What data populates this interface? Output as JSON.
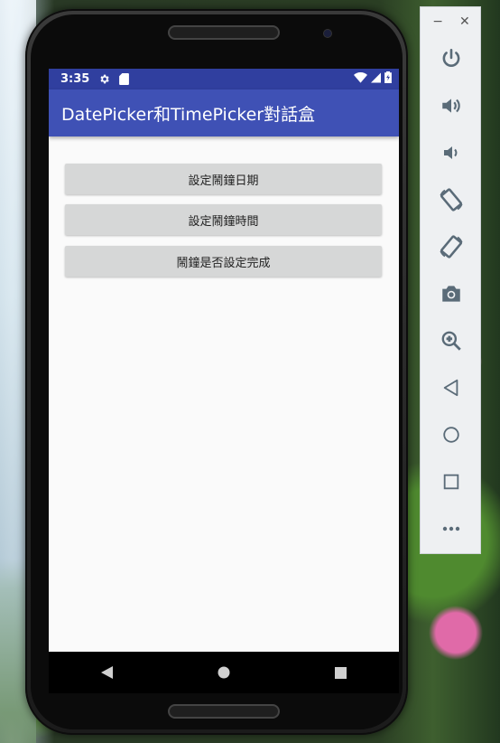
{
  "status_bar": {
    "time": "3:35"
  },
  "app_bar": {
    "title": "DatePicker和TimePicker對話盒"
  },
  "buttons": {
    "set_date": "設定鬧鐘日期",
    "set_time": "設定鬧鐘時間",
    "check_done": "鬧鐘是否設定完成"
  },
  "emulator_toolbar": {
    "minimize": "−",
    "close": "✕",
    "items": [
      "power",
      "volume-up",
      "volume-down",
      "rotate-left",
      "rotate-right",
      "screenshot",
      "zoom",
      "back",
      "home",
      "overview",
      "more"
    ]
  },
  "colors": {
    "status_bar": "#303f9f",
    "app_bar": "#3f51b5",
    "button_bg": "#d6d7d7",
    "toolbar_icon": "#5a6b78"
  }
}
